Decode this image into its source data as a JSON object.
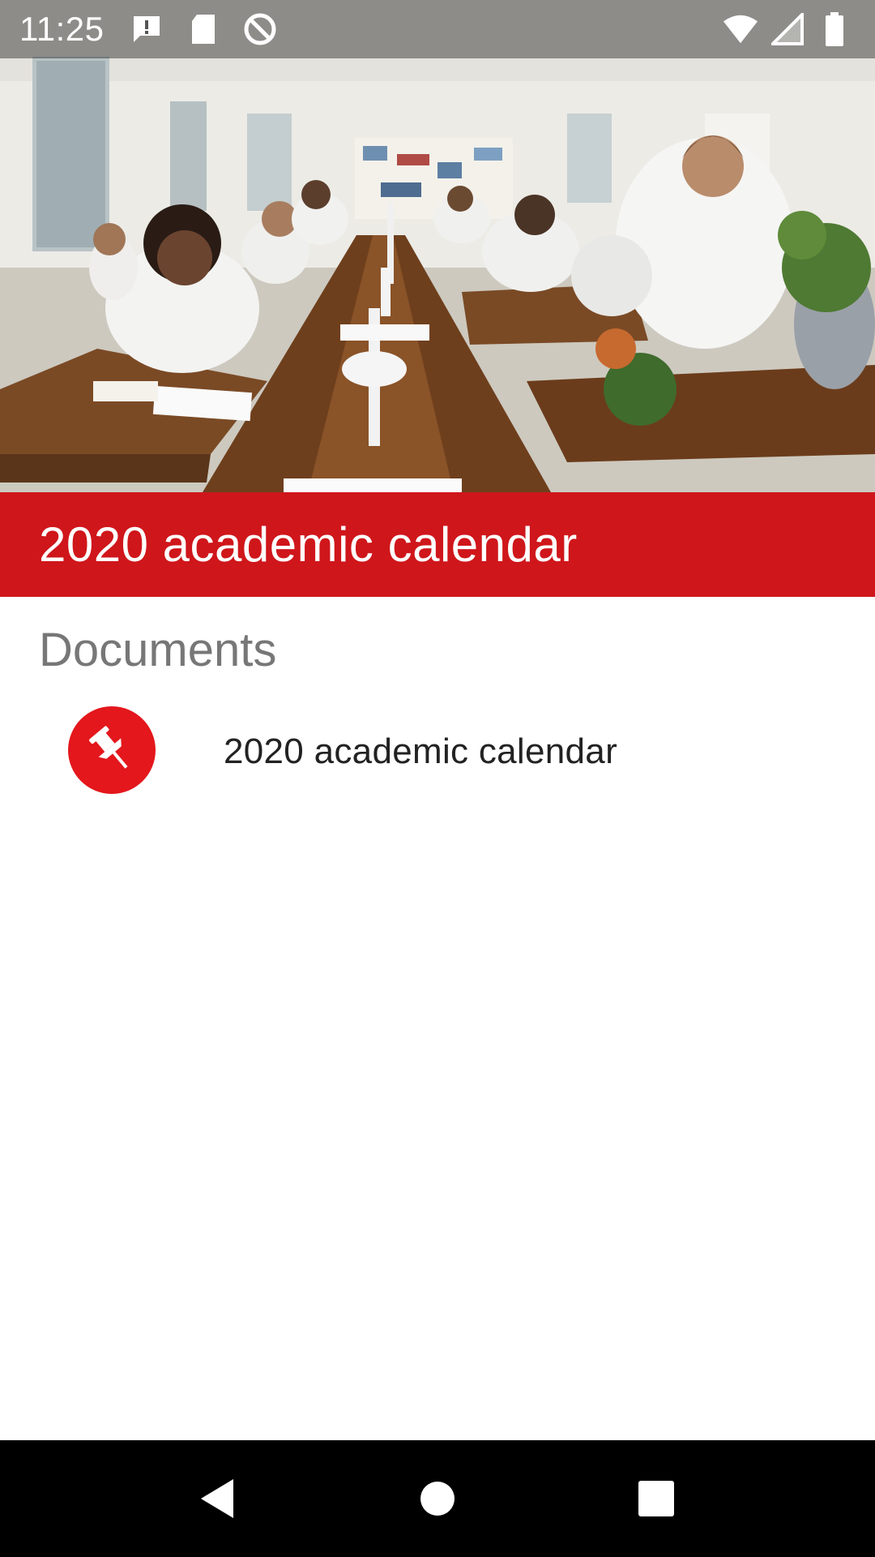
{
  "status_bar": {
    "time": "11:25",
    "left_icons": [
      "alert-message-icon",
      "sd-card-icon",
      "sync-disabled-icon"
    ],
    "right_icons": [
      "wifi-icon",
      "cellular-signal-icon",
      "battery-icon"
    ]
  },
  "hero": {
    "image": "classroom-lab-photo"
  },
  "header": {
    "title": "2020 academic calendar"
  },
  "documents": {
    "heading": "Documents",
    "items": [
      {
        "label": "2020 academic calendar",
        "icon": "pushpin-icon"
      }
    ]
  },
  "nav_bar": {
    "buttons": [
      "back-icon",
      "home-icon",
      "recents-icon"
    ]
  },
  "colors": {
    "accent": "#cf161b",
    "icon_bg": "#e3171c",
    "heading_gray": "#777777",
    "nav_bg": "#000000"
  }
}
